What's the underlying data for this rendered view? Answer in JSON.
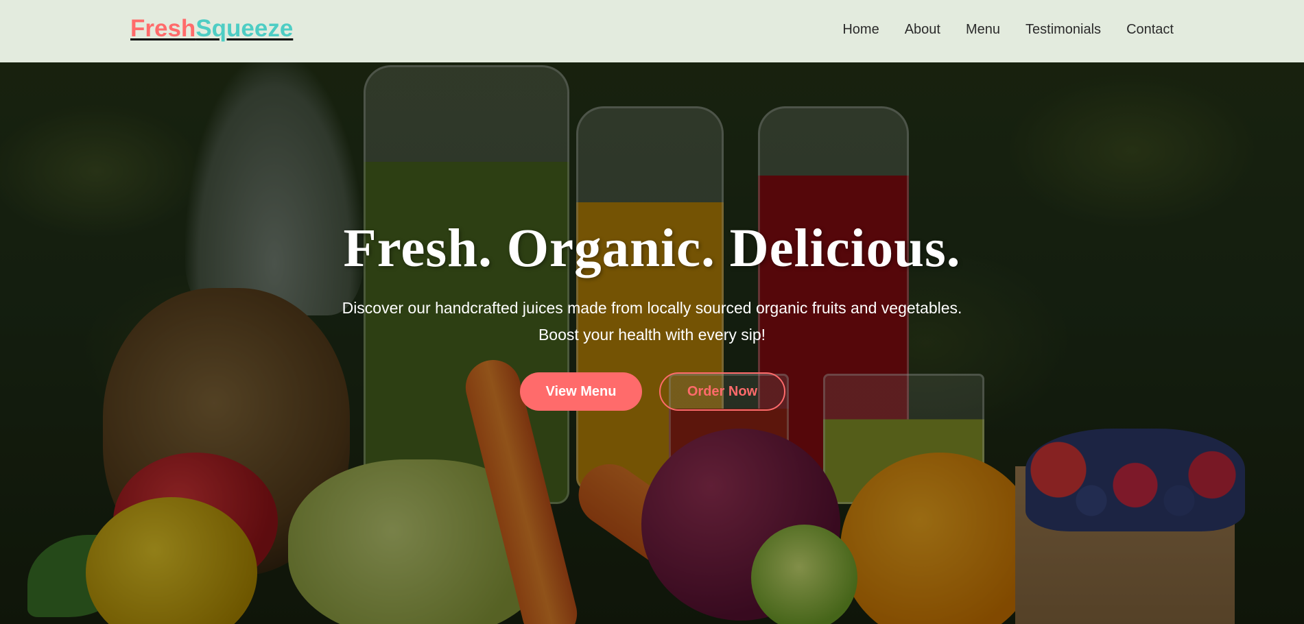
{
  "brand": {
    "part1": "Fresh",
    "part2": "Squeeze",
    "color1": "#ff6b6b",
    "color2": "#4ecdc4"
  },
  "nav": {
    "items": [
      "Home",
      "About",
      "Menu",
      "Testimonials",
      "Contact"
    ]
  },
  "hero": {
    "title": "Fresh. Organic. Delicious.",
    "subtitle_line1": "Discover our handcrafted juices made from locally sourced organic fruits and vegetables.",
    "subtitle_line2": "Boost your health with every sip!",
    "primary_button": "View Menu",
    "secondary_button": "Order Now",
    "background_image": "photo of fresh juices in glass jars surrounded by fruits and vegetables"
  },
  "colors": {
    "accent": "#ff6b6b",
    "nav_bg": "#f0f8ec",
    "nav_text": "#2b2b2b"
  }
}
